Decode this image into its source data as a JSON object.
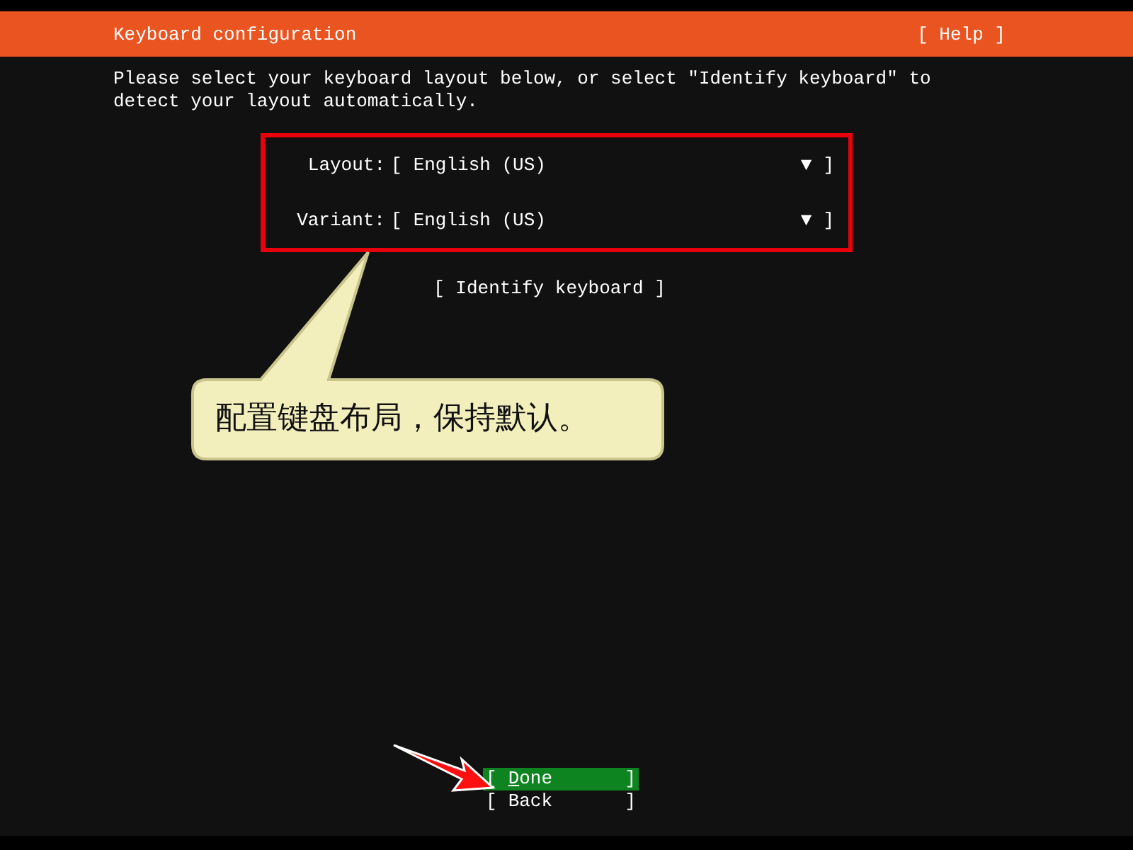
{
  "header": {
    "title": "Keyboard configuration",
    "help": "[ Help ]"
  },
  "intro": "Please select your keyboard layout below, or select \"Identify keyboard\" to detect your layout automatically.",
  "fields": [
    {
      "label": "Layout:",
      "open": "[",
      "value": "English (US)",
      "arrow": "▼",
      "close": "]"
    },
    {
      "label": "Variant:",
      "open": "[",
      "value": "English (US)",
      "arrow": "▼",
      "close": "]"
    }
  ],
  "identify_button": "[ Identify keyboard ]",
  "callout": {
    "text": "配置键盘布局，保持默认。"
  },
  "buttons": [
    {
      "open": "[",
      "label": "Done",
      "close": "]",
      "selected": true
    },
    {
      "open": "[",
      "label": "Back",
      "close": "]",
      "selected": false
    }
  ]
}
